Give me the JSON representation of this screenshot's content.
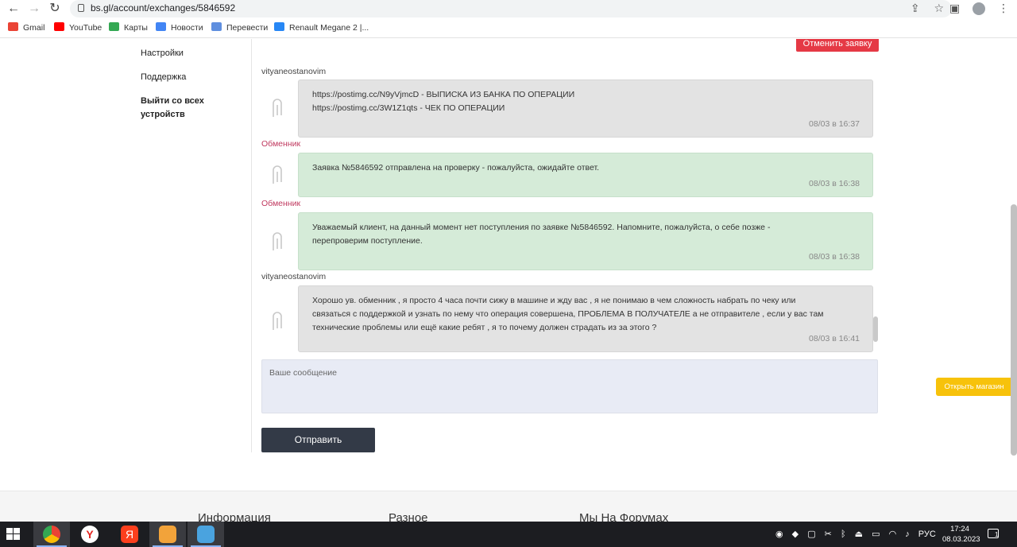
{
  "browser": {
    "url": "bs.gl/account/exchanges/5846592",
    "bookmarks": [
      "Gmail",
      "YouTube",
      "Карты",
      "Новости",
      "Перевести",
      "Renault Megane 2 |..."
    ]
  },
  "sidebar": {
    "items": [
      "Настройки",
      "Поддержка",
      "Выйти со всех устройств"
    ]
  },
  "cancel_button": "Отменить заявку",
  "messages": [
    {
      "author": "vityaneostanovim",
      "type": "user",
      "lines": [
        "https://postimg.cc/N9yVjmcD - ВЫПИСКА ИЗ БАНКА ПО ОПЕРАЦИИ",
        "https://postimg.cc/3W1Z1qts - ЧЕК ПО ОПЕРАЦИИ"
      ],
      "time": "08/03 в 16:37"
    },
    {
      "author": "Обменник",
      "type": "exchanger",
      "lines": [
        "Заявка №5846592 отправлена на проверку - пожалуйста, ожидайте ответ."
      ],
      "time": "08/03 в 16:38"
    },
    {
      "author": "Обменник",
      "type": "exchanger",
      "lines": [
        "Уважаемый клиент, на данный момент нет поступления по заявке №5846592. Напомните, пожалуйста, о себе позже -",
        "перепроверим поступление."
      ],
      "time": "08/03 в 16:38"
    },
    {
      "author": "vityaneostanovim",
      "type": "user",
      "lines": [
        "Хорошо ув. обменник , я просто 4 часа почти сижу в машине и жду вас , я не понимаю в чем сложность набрать по чеку или",
        "связаться с поддержкой и узнать по нему что операция совершена, ПРОБЛЕМА В ПОЛУЧАТЕЛЕ а не отправителе , если у вас там",
        "технические проблемы или ещё какие ребят , я то почему должен страдать из за этого ?"
      ],
      "time": "08/03 в 16:41"
    }
  ],
  "compose": {
    "placeholder": "Ваше сообщение"
  },
  "send_button": "Отправить",
  "shop_button": "Открыть магазин",
  "footer": {
    "headings": [
      "Информация",
      "Разное",
      "Мы На Форумах"
    ]
  },
  "taskbar": {
    "language": "РУС",
    "time": "17:24",
    "date": "08.03.2023",
    "notifications": "1"
  },
  "colors": {
    "cancel": "#e53945",
    "send": "#333a47",
    "shop": "#f7c20b",
    "exchanger_name": "#c0395f",
    "green_bubble": "#d5ebd8",
    "gray_bubble": "#e3e3e3"
  }
}
